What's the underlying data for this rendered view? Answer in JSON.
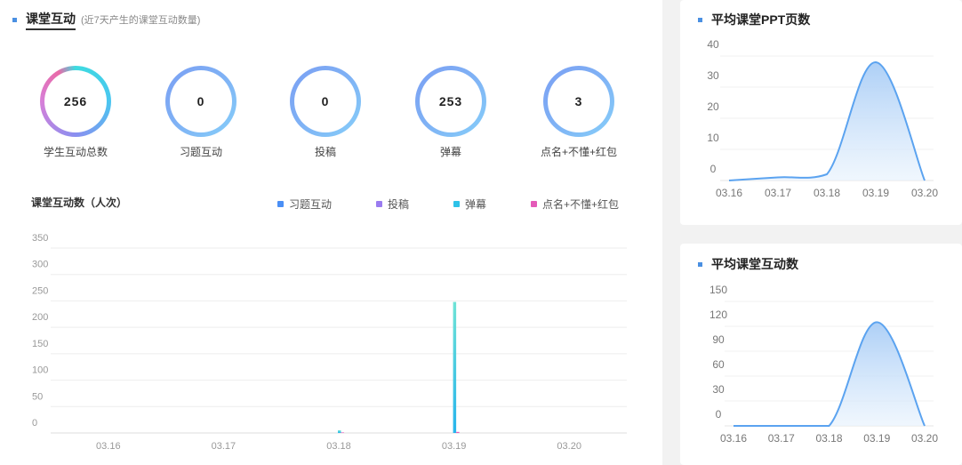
{
  "section": {
    "title": "课堂互动",
    "subtitle": "(近7天产生的课堂互动数量)"
  },
  "stats": [
    {
      "value": "256",
      "label": "学生互动总数"
    },
    {
      "value": "0",
      "label": "习题互动"
    },
    {
      "value": "0",
      "label": "投稿"
    },
    {
      "value": "253",
      "label": "弹幕"
    },
    {
      "value": "3",
      "label": "点名+不懂+红包"
    }
  ],
  "interaction_chart": {
    "heading": "课堂互动数（人次）"
  },
  "side_cards": {
    "ppt_title": "平均课堂PPT页数",
    "interaction_title": "平均课堂互动数"
  },
  "colors": {
    "accent": "#4a90e2",
    "exercise": "#4a8ff5",
    "submission": "#9a7cf0",
    "danmaku": "#2ec2e8",
    "rollcall": "#e45ab8",
    "area_line": "#5ba3f0"
  },
  "chart_data": [
    {
      "type": "bar",
      "title": "课堂互动数（人次）",
      "categories": [
        "03.16",
        "03.17",
        "03.18",
        "03.19",
        "03.20"
      ],
      "ylim": [
        0,
        350
      ],
      "yticks": [
        0,
        50,
        100,
        150,
        200,
        250,
        300,
        350
      ],
      "legend_position": "top-right",
      "series": [
        {
          "name": "习题互动",
          "values": [
            0,
            0,
            0,
            0,
            0
          ]
        },
        {
          "name": "投稿",
          "values": [
            0,
            0,
            0,
            0,
            0
          ]
        },
        {
          "name": "弹幕",
          "values": [
            0,
            0,
            5,
            248,
            0
          ]
        },
        {
          "name": "点名+不懂+红包",
          "values": [
            0,
            0,
            1,
            2,
            0
          ]
        }
      ]
    },
    {
      "type": "area",
      "title": "平均课堂PPT页数",
      "x": [
        "03.16",
        "03.17",
        "03.18",
        "03.19",
        "03.20"
      ],
      "ylim": [
        0,
        40
      ],
      "yticks": [
        0,
        10,
        20,
        30,
        40
      ],
      "series": [
        {
          "values": [
            0,
            1,
            2,
            38,
            0
          ]
        }
      ]
    },
    {
      "type": "area",
      "title": "平均课堂互动数",
      "x": [
        "03.16",
        "03.17",
        "03.18",
        "03.19",
        "03.20"
      ],
      "ylim": [
        0,
        150
      ],
      "yticks": [
        0,
        30,
        60,
        90,
        120,
        150
      ],
      "series": [
        {
          "values": [
            0,
            0,
            0,
            125,
            0
          ]
        }
      ]
    }
  ]
}
